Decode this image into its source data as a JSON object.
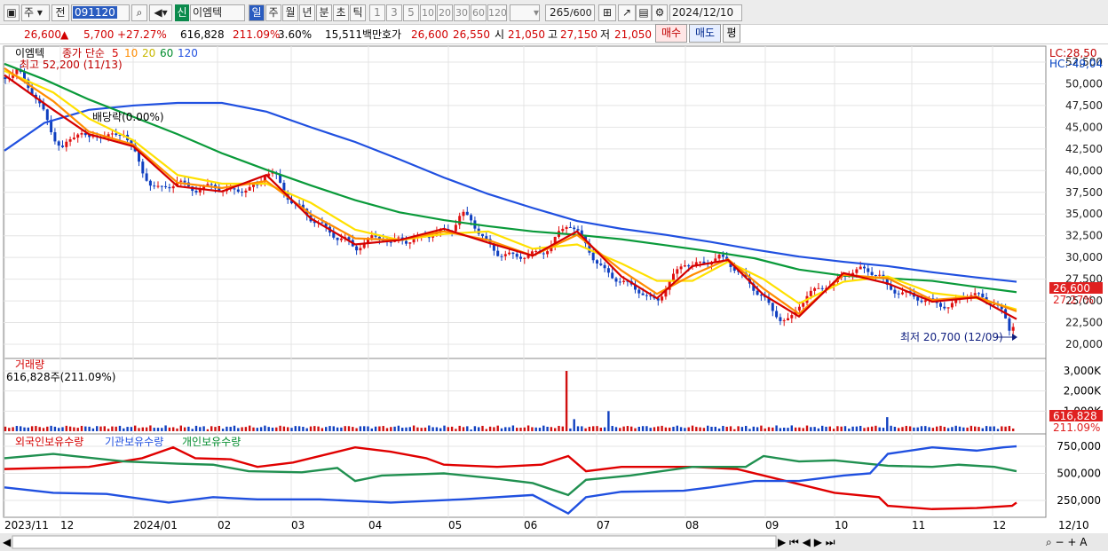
{
  "toolbar": {
    "mode": "주",
    "type": "전",
    "code": "091120",
    "badge": "신",
    "name": "이엠텍",
    "periods": [
      "일",
      "주",
      "월",
      "년",
      "분",
      "초",
      "틱"
    ],
    "intervals": [
      "1",
      "3",
      "5",
      "10",
      "20",
      "30",
      "60",
      "120"
    ],
    "count": "265",
    "count_total": "/600",
    "date": "2024/12/10"
  },
  "quote": {
    "price": "26,600",
    "arrow": "▲",
    "change": "5,700",
    "change_pct": "+27.27%",
    "volume": "616,828",
    "vol_ratio": "211.09%",
    "turnover": "3.60%",
    "amount": "15,511백만",
    "hoga_label": "호가",
    "ask": "26,600",
    "bid": "26,550",
    "open_label": "시",
    "open": "21,050",
    "high_label": "고",
    "high": "27,150",
    "low_label": "저",
    "low": "21,050",
    "buy": "매수",
    "sell": "매도",
    "eval": "평"
  },
  "price_panel": {
    "title": "이엠텍",
    "legend_head": "종가 단순",
    "mas": [
      {
        "p": "5",
        "c": "#d40000"
      },
      {
        "p": "10",
        "c": "#ff8c00"
      },
      {
        "p": "20",
        "c": "#e6d800"
      },
      {
        "p": "60",
        "c": "#008c2c"
      },
      {
        "p": "120",
        "c": "#2050e0"
      }
    ],
    "high_note": "최고 52,200 (11/13)",
    "low_note": "최저 20,700 (12/09)",
    "div_note": "배당락(0.00%)",
    "lc": "LC:28,50",
    "hc": "HC:-49,04",
    "last": "26,600",
    "last_pct": "27.27%",
    "y_ticks": [
      "52,500",
      "50,000",
      "47,500",
      "45,000",
      "42,500",
      "40,000",
      "37,500",
      "35,000",
      "32,500",
      "30,000",
      "27,500",
      "25,000",
      "22,500",
      "20,000"
    ]
  },
  "volume_panel": {
    "title": "거래량",
    "value": "616,828주(211.09%)",
    "y_ticks": [
      "3,000K",
      "2,000K",
      "1,000K"
    ],
    "last": "616,828",
    "last_pct": "211.09%"
  },
  "holding_panel": {
    "foreign": "외국인보유수량",
    "inst": "기관보유수량",
    "indiv": "개인보유수량",
    "y_ticks": [
      "750,000",
      "500,000",
      "250,000"
    ]
  },
  "x_axis": [
    "2023/11",
    "12",
    "2024/01",
    "02",
    "03",
    "04",
    "05",
    "06",
    "07",
    "08",
    "09",
    "10",
    "11",
    "12",
    "12/10"
  ],
  "chart_data": {
    "type": "candlestick",
    "price_range": [
      20000,
      52500
    ],
    "close_points": [
      [
        0,
        50500
      ],
      [
        10,
        51000
      ],
      [
        20,
        51500
      ],
      [
        30,
        50000
      ],
      [
        40,
        48500
      ],
      [
        50,
        46500
      ],
      [
        60,
        44000
      ],
      [
        70,
        42500
      ],
      [
        80,
        43500
      ],
      [
        90,
        44800
      ],
      [
        100,
        43500
      ],
      [
        110,
        44000
      ],
      [
        120,
        44200
      ],
      [
        130,
        43800
      ],
      [
        140,
        44500
      ],
      [
        150,
        42500
      ],
      [
        160,
        39800
      ],
      [
        170,
        38500
      ],
      [
        180,
        37800
      ],
      [
        190,
        38200
      ],
      [
        200,
        38800
      ],
      [
        210,
        38200
      ],
      [
        220,
        37800
      ],
      [
        230,
        38000
      ],
      [
        240,
        38300
      ],
      [
        250,
        37800
      ],
      [
        260,
        37600
      ],
      [
        270,
        37800
      ],
      [
        280,
        37900
      ],
      [
        290,
        38200
      ],
      [
        300,
        40000
      ],
      [
        310,
        39500
      ],
      [
        320,
        37500
      ],
      [
        330,
        36300
      ],
      [
        340,
        35500
      ],
      [
        350,
        34500
      ],
      [
        360,
        33900
      ],
      [
        370,
        33000
      ],
      [
        380,
        32300
      ],
      [
        390,
        32000
      ],
      [
        400,
        31000
      ],
      [
        410,
        31700
      ],
      [
        420,
        32300
      ],
      [
        430,
        32400
      ],
      [
        440,
        31500
      ],
      [
        450,
        32300
      ],
      [
        460,
        31800
      ],
      [
        470,
        32100
      ],
      [
        480,
        32600
      ],
      [
        490,
        32700
      ],
      [
        500,
        33100
      ],
      [
        510,
        33400
      ],
      [
        520,
        35000
      ],
      [
        530,
        34500
      ],
      [
        540,
        32800
      ],
      [
        550,
        31500
      ],
      [
        560,
        30500
      ],
      [
        570,
        30300
      ],
      [
        580,
        30100
      ],
      [
        590,
        30200
      ],
      [
        600,
        30400
      ],
      [
        610,
        30500
      ],
      [
        620,
        31300
      ],
      [
        630,
        32800
      ],
      [
        640,
        34000
      ],
      [
        650,
        33000
      ],
      [
        660,
        31500
      ],
      [
        670,
        29700
      ],
      [
        680,
        28500
      ],
      [
        690,
        27800
      ],
      [
        700,
        27200
      ],
      [
        710,
        26800
      ],
      [
        720,
        26200
      ],
      [
        730,
        25300
      ],
      [
        740,
        25000
      ],
      [
        750,
        26500
      ],
      [
        760,
        28000
      ],
      [
        770,
        29500
      ],
      [
        780,
        29000
      ],
      [
        790,
        29300
      ],
      [
        800,
        29600
      ],
      [
        810,
        30000
      ],
      [
        820,
        29500
      ],
      [
        830,
        28500
      ],
      [
        840,
        27500
      ],
      [
        850,
        26300
      ],
      [
        860,
        25400
      ],
      [
        870,
        23800
      ],
      [
        880,
        22900
      ],
      [
        890,
        22700
      ],
      [
        900,
        24500
      ],
      [
        910,
        25800
      ],
      [
        920,
        26200
      ],
      [
        930,
        26800
      ],
      [
        940,
        27000
      ],
      [
        950,
        27900
      ],
      [
        960,
        28400
      ],
      [
        970,
        28600
      ],
      [
        980,
        28400
      ],
      [
        990,
        28000
      ],
      [
        1000,
        26500
      ],
      [
        1010,
        26100
      ],
      [
        1020,
        25800
      ],
      [
        1030,
        25500
      ],
      [
        1040,
        25100
      ],
      [
        1050,
        24900
      ],
      [
        1060,
        24600
      ],
      [
        1070,
        24200
      ],
      [
        1080,
        25300
      ],
      [
        1090,
        25800
      ],
      [
        1100,
        25600
      ],
      [
        1110,
        25200
      ],
      [
        1120,
        24700
      ],
      [
        1130,
        23500
      ],
      [
        1140,
        21000
      ],
      [
        1145,
        26600
      ]
    ],
    "ma120": [
      [
        5,
        42300
      ],
      [
        50,
        45500
      ],
      [
        100,
        47000
      ],
      [
        150,
        47500
      ],
      [
        200,
        47800
      ],
      [
        250,
        47800
      ],
      [
        300,
        46800
      ],
      [
        350,
        45000
      ],
      [
        400,
        43300
      ],
      [
        450,
        41300
      ],
      [
        500,
        39200
      ],
      [
        550,
        37300
      ],
      [
        600,
        35700
      ],
      [
        650,
        34200
      ],
      [
        700,
        33300
      ],
      [
        750,
        32600
      ],
      [
        800,
        31800
      ],
      [
        850,
        30900
      ],
      [
        900,
        30100
      ],
      [
        950,
        29500
      ],
      [
        1000,
        29000
      ],
      [
        1050,
        28300
      ],
      [
        1100,
        27700
      ],
      [
        1145,
        27200
      ]
    ],
    "ma60": [
      [
        5,
        52300
      ],
      [
        50,
        50500
      ],
      [
        100,
        48200
      ],
      [
        150,
        46200
      ],
      [
        200,
        44200
      ],
      [
        250,
        42000
      ],
      [
        300,
        40100
      ],
      [
        350,
        38300
      ],
      [
        400,
        36600
      ],
      [
        450,
        35200
      ],
      [
        500,
        34300
      ],
      [
        550,
        33600
      ],
      [
        600,
        33000
      ],
      [
        650,
        32600
      ],
      [
        700,
        32100
      ],
      [
        750,
        31400
      ],
      [
        800,
        30700
      ],
      [
        850,
        29900
      ],
      [
        900,
        28600
      ],
      [
        950,
        27900
      ],
      [
        1000,
        27600
      ],
      [
        1050,
        27300
      ],
      [
        1100,
        26600
      ],
      [
        1145,
        26000
      ]
    ],
    "ma20": [
      [
        5,
        51500
      ],
      [
        60,
        49000
      ],
      [
        100,
        46000
      ],
      [
        150,
        43500
      ],
      [
        200,
        39500
      ],
      [
        250,
        38500
      ],
      [
        300,
        38500
      ],
      [
        350,
        36300
      ],
      [
        400,
        33200
      ],
      [
        450,
        32000
      ],
      [
        500,
        32700
      ],
      [
        550,
        33000
      ],
      [
        600,
        31000
      ],
      [
        650,
        31500
      ],
      [
        700,
        29300
      ],
      [
        740,
        27300
      ],
      [
        780,
        27300
      ],
      [
        820,
        29500
      ],
      [
        860,
        27500
      ],
      [
        900,
        24700
      ],
      [
        950,
        27200
      ],
      [
        1000,
        27800
      ],
      [
        1050,
        25900
      ],
      [
        1100,
        25300
      ],
      [
        1145,
        24000
      ]
    ],
    "ma10": [
      [
        5,
        51800
      ],
      [
        60,
        48000
      ],
      [
        100,
        44500
      ],
      [
        150,
        43000
      ],
      [
        200,
        38600
      ],
      [
        250,
        38000
      ],
      [
        300,
        38800
      ],
      [
        350,
        35000
      ],
      [
        400,
        32200
      ],
      [
        450,
        32000
      ],
      [
        500,
        33000
      ],
      [
        550,
        32000
      ],
      [
        600,
        30200
      ],
      [
        650,
        32600
      ],
      [
        700,
        28500
      ],
      [
        740,
        25800
      ],
      [
        780,
        28000
      ],
      [
        820,
        29800
      ],
      [
        860,
        26400
      ],
      [
        900,
        23500
      ],
      [
        950,
        28000
      ],
      [
        1000,
        27600
      ],
      [
        1050,
        25100
      ],
      [
        1100,
        25500
      ],
      [
        1145,
        23800
      ]
    ],
    "ma5": [
      [
        5,
        51000
      ],
      [
        60,
        47000
      ],
      [
        100,
        44200
      ],
      [
        150,
        42800
      ],
      [
        200,
        38200
      ],
      [
        250,
        37600
      ],
      [
        300,
        39500
      ],
      [
        350,
        34500
      ],
      [
        400,
        31500
      ],
      [
        450,
        32000
      ],
      [
        500,
        33300
      ],
      [
        550,
        31700
      ],
      [
        600,
        30200
      ],
      [
        650,
        33000
      ],
      [
        700,
        27800
      ],
      [
        740,
        25300
      ],
      [
        780,
        29000
      ],
      [
        820,
        29700
      ],
      [
        860,
        25700
      ],
      [
        900,
        23200
      ],
      [
        950,
        28200
      ],
      [
        1000,
        27000
      ],
      [
        1050,
        24900
      ],
      [
        1100,
        25400
      ],
      [
        1145,
        22900
      ]
    ],
    "volume_spikes": [
      [
        640,
        3000
      ],
      [
        645,
        600
      ],
      [
        685,
        1000
      ],
      [
        1000,
        700
      ],
      [
        1145,
        616
      ]
    ],
    "foreign": [
      [
        5,
        540
      ],
      [
        100,
        560
      ],
      [
        160,
        640
      ],
      [
        195,
        740
      ],
      [
        220,
        640
      ],
      [
        260,
        630
      ],
      [
        290,
        560
      ],
      [
        330,
        600
      ],
      [
        400,
        740
      ],
      [
        440,
        700
      ],
      [
        480,
        640
      ],
      [
        500,
        580
      ],
      [
        560,
        560
      ],
      [
        610,
        580
      ],
      [
        640,
        660
      ],
      [
        660,
        520
      ],
      [
        700,
        560
      ],
      [
        780,
        560
      ],
      [
        830,
        540
      ],
      [
        860,
        480
      ],
      [
        900,
        400
      ],
      [
        940,
        320
      ],
      [
        990,
        280
      ],
      [
        1000,
        200
      ],
      [
        1050,
        170
      ],
      [
        1100,
        180
      ],
      [
        1140,
        200
      ],
      [
        1145,
        230
      ]
    ],
    "institution": [
      [
        5,
        370
      ],
      [
        60,
        320
      ],
      [
        120,
        310
      ],
      [
        190,
        230
      ],
      [
        240,
        280
      ],
      [
        290,
        260
      ],
      [
        360,
        260
      ],
      [
        440,
        230
      ],
      [
        520,
        260
      ],
      [
        600,
        300
      ],
      [
        640,
        130
      ],
      [
        660,
        280
      ],
      [
        700,
        330
      ],
      [
        770,
        340
      ],
      [
        800,
        370
      ],
      [
        850,
        430
      ],
      [
        900,
        430
      ],
      [
        950,
        480
      ],
      [
        980,
        500
      ],
      [
        1000,
        680
      ],
      [
        1050,
        740
      ],
      [
        1100,
        710
      ],
      [
        1130,
        740
      ],
      [
        1145,
        750
      ]
    ],
    "individual": [
      [
        5,
        640
      ],
      [
        60,
        680
      ],
      [
        140,
        610
      ],
      [
        200,
        590
      ],
      [
        240,
        580
      ],
      [
        280,
        520
      ],
      [
        340,
        510
      ],
      [
        380,
        550
      ],
      [
        400,
        430
      ],
      [
        430,
        480
      ],
      [
        500,
        500
      ],
      [
        560,
        450
      ],
      [
        600,
        410
      ],
      [
        640,
        300
      ],
      [
        660,
        440
      ],
      [
        710,
        480
      ],
      [
        780,
        560
      ],
      [
        840,
        560
      ],
      [
        860,
        660
      ],
      [
        900,
        610
      ],
      [
        940,
        620
      ],
      [
        1000,
        570
      ],
      [
        1050,
        560
      ],
      [
        1080,
        580
      ],
      [
        1120,
        560
      ],
      [
        1145,
        520
      ]
    ]
  }
}
